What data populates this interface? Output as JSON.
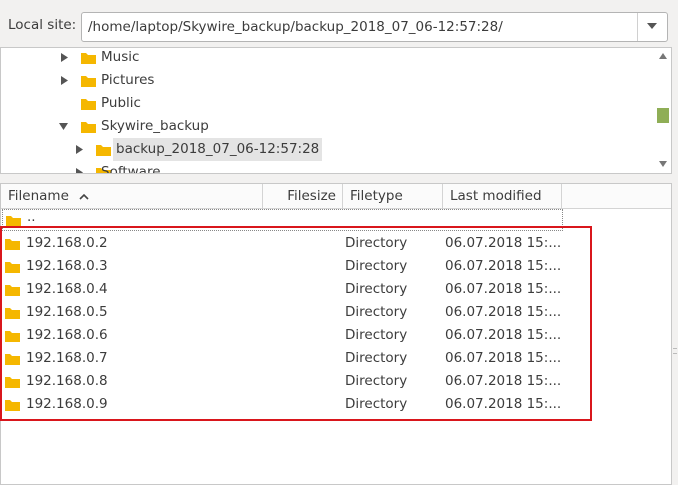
{
  "site_bar": {
    "label": "Local site:",
    "path": "/home/laptop/Skywire_backup/backup_2018_07_06-12:57:28/"
  },
  "tree": {
    "items": [
      {
        "label": "Music",
        "expander": "collapsed"
      },
      {
        "label": "Pictures",
        "expander": "collapsed"
      },
      {
        "label": "Public",
        "expander": "none"
      },
      {
        "label": "Skywire_backup",
        "expander": "expanded"
      },
      {
        "label": "backup_2018_07_06-12:57:28",
        "expander": "collapsed",
        "selected": true
      },
      {
        "label": "Software",
        "expander": "collapsed"
      }
    ]
  },
  "file_list": {
    "columns": [
      "Filename",
      "Filesize",
      "Filetype",
      "Last modified"
    ],
    "sort_column": "Filename",
    "sort_direction": "ascending",
    "parent_entry": "..",
    "rows": [
      {
        "name": "192.168.0.2",
        "type": "Directory",
        "modified": "06.07.2018 15:..."
      },
      {
        "name": "192.168.0.3",
        "type": "Directory",
        "modified": "06.07.2018 15:..."
      },
      {
        "name": "192.168.0.4",
        "type": "Directory",
        "modified": "06.07.2018 15:..."
      },
      {
        "name": "192.168.0.5",
        "type": "Directory",
        "modified": "06.07.2018 15:..."
      },
      {
        "name": "192.168.0.6",
        "type": "Directory",
        "modified": "06.07.2018 15:..."
      },
      {
        "name": "192.168.0.7",
        "type": "Directory",
        "modified": "06.07.2018 15:..."
      },
      {
        "name": "192.168.0.8",
        "type": "Directory",
        "modified": "06.07.2018 15:..."
      },
      {
        "name": "192.168.0.9",
        "type": "Directory",
        "modified": "06.07.2018 15:..."
      }
    ]
  },
  "colors": {
    "folder": "#f5b700",
    "highlight": "#d9161c",
    "scroll_thumb": "#8fae56"
  }
}
